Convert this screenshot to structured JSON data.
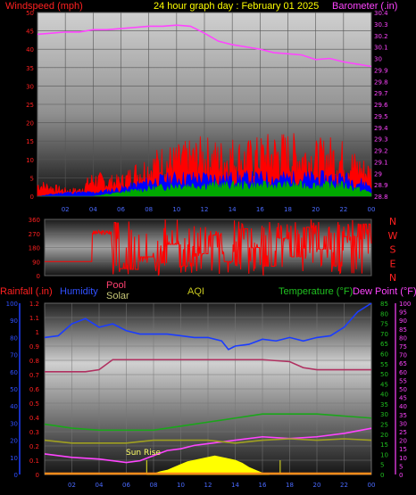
{
  "header": {
    "title": "24 hour graph day : February 01 2025",
    "left_label": "Windspeed (mph)",
    "right_label": "Barometer (.in)"
  },
  "x_ticks": [
    "02",
    "04",
    "06",
    "08",
    "10",
    "12",
    "14",
    "16",
    "18",
    "20",
    "22",
    "00"
  ],
  "panel_labels": {
    "rain": "Rainfall (.in)",
    "humidity": "Humidity",
    "pool": "Pool",
    "solar": "Solar",
    "aqi": "AQI",
    "temperature": "Temperature (°F)",
    "dewpoint": "Dew Point (°F)",
    "sunrise": "Sun Rise"
  },
  "colors": {
    "title": "#ffff00",
    "windspeed": "#ff0000",
    "gust": "#ff0000",
    "wind_avg": "#0000ff",
    "wind_low": "#00aa00",
    "barometer": "#ff44ff",
    "direction": "#ff0000",
    "humidity": "#1a3cff",
    "temperature": "#1aa61a",
    "dewpoint": "#ff44ff",
    "pool": "#b03060",
    "solar": "#ffff00",
    "aqi": "#a0a020",
    "rain": "#ff8c1a",
    "grid_dark": "#1e1e1e",
    "grid_light": "#c0c0c0"
  },
  "chart_data": [
    {
      "type": "line",
      "name": "wind_baro",
      "xlabel": "",
      "ylabel": "Windspeed (mph)",
      "ylim": [
        0,
        50
      ],
      "y2lim": [
        28.8,
        30.4
      ],
      "y_ticks": [
        0,
        5,
        10,
        15,
        20,
        25,
        30,
        35,
        40,
        45,
        50
      ],
      "y2_ticks": [
        "28.8",
        "28.9",
        "29",
        "29.1",
        "29.2",
        "29.3",
        "29.4",
        "29.5",
        "29.6",
        "29.7",
        "29.8",
        "29.9",
        "30",
        "30.1",
        "30.2",
        "30.3",
        "30.4"
      ],
      "series": [
        {
          "name": "Barometer",
          "axis": "y2",
          "x": [
            0,
            1,
            2,
            3,
            4,
            5,
            6,
            7,
            8,
            9,
            10,
            11,
            12,
            13,
            14,
            15,
            16,
            17,
            18,
            19,
            20,
            21,
            22,
            23,
            24
          ],
          "values": [
            30.21,
            30.22,
            30.23,
            30.23,
            30.25,
            30.25,
            30.26,
            30.27,
            30.28,
            30.28,
            30.29,
            30.28,
            30.22,
            30.15,
            30.12,
            30.1,
            30.08,
            30.05,
            30.04,
            30.03,
            29.99,
            30.0,
            29.97,
            29.95,
            29.93
          ]
        },
        {
          "name": "Windspeed",
          "axis": "y",
          "x": [
            0,
            1,
            2,
            3,
            4,
            5,
            6,
            7,
            8,
            9,
            10,
            11,
            12,
            13,
            14,
            15,
            16,
            17,
            18,
            19,
            20,
            21,
            22,
            23,
            24
          ],
          "values": [
            4,
            3,
            2,
            2,
            6,
            5,
            5,
            8,
            10,
            12,
            12,
            13,
            14,
            13,
            14,
            13,
            14,
            15,
            15,
            14,
            13,
            14,
            13,
            10,
            8
          ]
        },
        {
          "name": "Wind Avg",
          "axis": "y",
          "x": [
            0,
            2,
            4,
            6,
            8,
            10,
            12,
            14,
            16,
            18,
            20,
            22,
            24
          ],
          "values": [
            0,
            1,
            1,
            2,
            4,
            5,
            5,
            5,
            5,
            5,
            5,
            5,
            3
          ]
        },
        {
          "name": "Wind Low",
          "axis": "y",
          "x": [
            0,
            2,
            4,
            6,
            8,
            10,
            12,
            14,
            16,
            18,
            20,
            22,
            24
          ],
          "values": [
            0,
            0,
            0,
            1,
            2,
            3,
            3,
            3,
            3,
            3,
            3,
            3,
            1
          ]
        }
      ]
    },
    {
      "type": "scatter",
      "name": "wind_direction",
      "ylim": [
        0,
        360
      ],
      "y_ticks": [
        0,
        90,
        180,
        270,
        360
      ],
      "compass": [
        "N",
        "W",
        "S",
        "E",
        "N"
      ],
      "series": [
        {
          "name": "Direction",
          "x": [
            0,
            1,
            2,
            3,
            4,
            4.5,
            5,
            5.5,
            6,
            7,
            8,
            9,
            10,
            11,
            12,
            13,
            14,
            15,
            16,
            17,
            18,
            19,
            20,
            21,
            22,
            23,
            24
          ],
          "values": [
            90,
            90,
            90,
            90,
            90,
            280,
            340,
            45,
            40,
            120,
            80,
            200,
            60,
            140,
            260,
            90,
            300,
            180,
            60,
            240,
            120,
            310,
            170,
            60,
            250,
            330,
            50
          ]
        }
      ]
    },
    {
      "type": "line",
      "name": "temp_humidity",
      "rain_ylim": [
        0,
        1.2
      ],
      "humidity_ylim": [
        0,
        100
      ],
      "temp_ylim": [
        0,
        85
      ],
      "dew_ylim": [
        0,
        100
      ],
      "rain_ticks": [
        "0",
        "0.1",
        "0.2",
        "0.3",
        "0.4",
        "0.5",
        "0.6",
        "0.7",
        "0.8",
        "0.9",
        "1",
        "1.1",
        "1.2"
      ],
      "humidity_ticks": [
        0,
        10,
        20,
        30,
        40,
        50,
        60,
        70,
        80,
        90,
        100
      ],
      "temp_ticks": [
        0,
        5,
        10,
        15,
        20,
        25,
        30,
        35,
        40,
        45,
        50,
        55,
        60,
        65,
        70,
        75,
        80,
        85
      ],
      "dew_ticks": [
        0,
        5,
        10,
        15,
        20,
        25,
        30,
        35,
        40,
        45,
        50,
        55,
        60,
        65,
        70,
        75,
        80,
        85,
        90,
        95,
        100
      ],
      "series": [
        {
          "name": "Humidity",
          "axis": "humidity",
          "x": [
            0,
            1,
            2,
            3,
            4,
            5,
            6,
            7,
            8,
            9,
            10,
            11,
            12,
            13,
            13.5,
            14,
            15,
            16,
            17,
            18,
            19,
            20,
            21,
            22,
            23,
            24
          ],
          "values": [
            80,
            81,
            88,
            91,
            86,
            88,
            84,
            82,
            82,
            82,
            81,
            80,
            80,
            78,
            73,
            75,
            76,
            79,
            78,
            80,
            78,
            80,
            81,
            86,
            95,
            100
          ]
        },
        {
          "name": "Pool",
          "axis": "temp",
          "x": [
            0,
            2,
            3,
            4,
            5,
            6,
            8,
            10,
            12,
            14,
            16,
            18,
            19,
            20,
            22,
            24
          ],
          "values": [
            51,
            51,
            51,
            52,
            57,
            57,
            57,
            57,
            57,
            57,
            57,
            56,
            53,
            52,
            52,
            52
          ]
        },
        {
          "name": "Temperature",
          "axis": "temp",
          "x": [
            0,
            2,
            4,
            6,
            8,
            10,
            12,
            14,
            16,
            18,
            20,
            22,
            24
          ],
          "values": [
            25,
            23,
            22,
            22,
            22,
            24,
            26,
            28,
            30,
            30,
            30,
            29,
            28
          ]
        },
        {
          "name": "Dew Point",
          "axis": "dew",
          "x": [
            0,
            2,
            4,
            6,
            7,
            8,
            9,
            10,
            11,
            12,
            14,
            16,
            18,
            20,
            22,
            24
          ],
          "values": [
            12,
            10,
            9,
            7,
            8,
            11,
            14,
            15,
            17,
            18,
            20,
            22,
            21,
            22,
            24,
            27
          ]
        },
        {
          "name": "AQI",
          "axis": "rain",
          "x": [
            0,
            2,
            4,
            6,
            8,
            10,
            12,
            14,
            16,
            18,
            20,
            22,
            24
          ],
          "values": [
            0.24,
            0.22,
            0.22,
            0.22,
            0.24,
            0.24,
            0.24,
            0.22,
            0.24,
            0.25,
            0.24,
            0.25,
            0.24
          ]
        },
        {
          "name": "Solar",
          "axis": "rain",
          "x": [
            7.5,
            8,
            8.5,
            9,
            9.5,
            10,
            10.5,
            11,
            11.5,
            12,
            12.5,
            13,
            13.5,
            14,
            14.5,
            15,
            15.5,
            16,
            16.5
          ],
          "values": [
            0,
            0.005,
            0.02,
            0.03,
            0.05,
            0.07,
            0.09,
            0.1,
            0.11,
            0.12,
            0.13,
            0.12,
            0.11,
            0.1,
            0.08,
            0.05,
            0.03,
            0.01,
            0
          ]
        },
        {
          "name": "Rainfall",
          "axis": "rain",
          "x": [
            0,
            24
          ],
          "values": [
            0,
            0
          ]
        }
      ],
      "annotations": [
        "Sun Rise"
      ]
    }
  ]
}
